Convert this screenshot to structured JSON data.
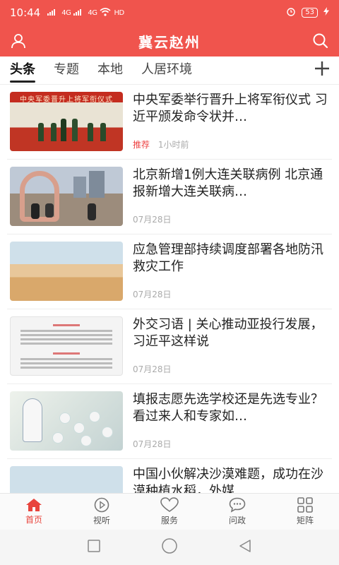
{
  "status_bar": {
    "time": "10:44",
    "signal1": "4G",
    "signal2": "4G",
    "wifi_label": "HD",
    "battery": "53"
  },
  "header": {
    "title": "冀云赵州",
    "user_icon": "user-icon",
    "search_icon": "search-icon"
  },
  "tabs": [
    {
      "label": "头条",
      "active": true
    },
    {
      "label": "专题"
    },
    {
      "label": "本地"
    },
    {
      "label": "人居环境"
    }
  ],
  "news": [
    {
      "title": "中央军委举行晋升上将军衔仪式 习近平颁发命令状并…",
      "tag": "推荐",
      "time": "1小时前",
      "thumb_banner": "中央军委晋升上将军衔仪式"
    },
    {
      "title": "北京新增1例大连关联病例 北京通报新增大连关联病…",
      "time": "07月28日"
    },
    {
      "title": "应急管理部持续调度部署各地防汛救灾工作",
      "time": "07月28日"
    },
    {
      "title": "外交习语 | 关心推动亚投行发展，习近平这样说",
      "time": "07月28日"
    },
    {
      "title": "填报志愿先选学校还是先选专业？ 看过来人和专家如…",
      "time": "07月28日"
    },
    {
      "title": "中国小伙解决沙漠难题，成功在沙漠种植水稻，外媒…",
      "time": ""
    }
  ],
  "bottom_nav": [
    {
      "label": "首页",
      "icon": "home-icon",
      "active": true
    },
    {
      "label": "视听",
      "icon": "play-icon"
    },
    {
      "label": "服务",
      "icon": "heart-icon"
    },
    {
      "label": "问政",
      "icon": "chat-icon"
    },
    {
      "label": "矩阵",
      "icon": "grid-icon"
    }
  ],
  "colors": {
    "brand": "#f0544d",
    "accent_active": "#e8443c"
  }
}
